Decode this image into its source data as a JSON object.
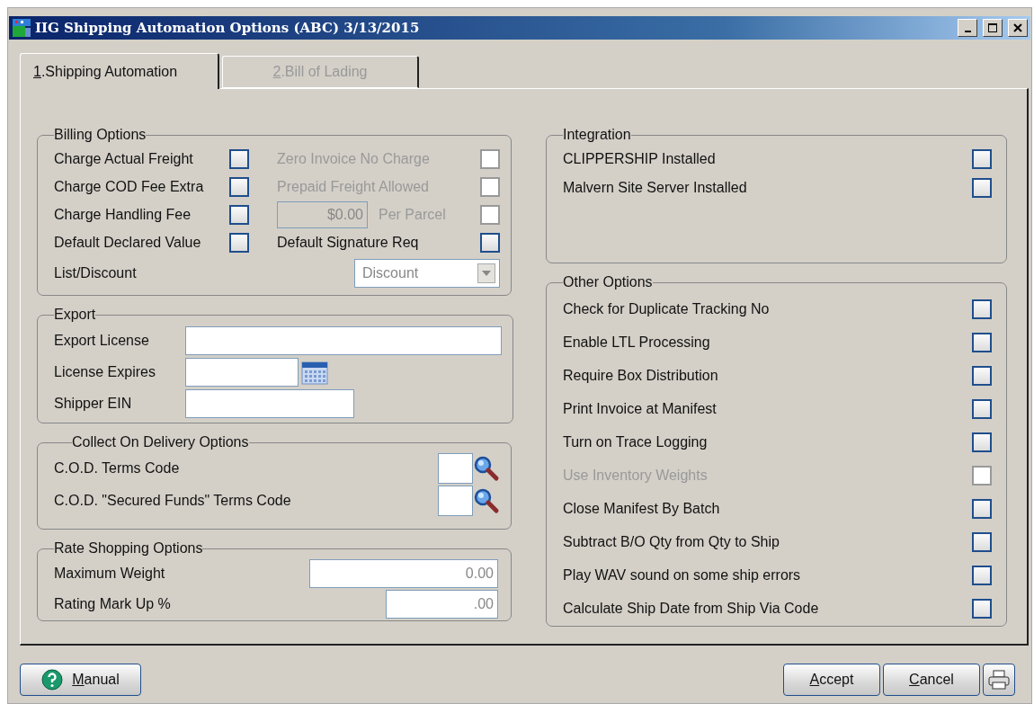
{
  "window": {
    "title": "IIG Shipping Automation Options (ABC) 3/13/2015"
  },
  "tabs": [
    {
      "key": "1",
      "rest": ".Shipping Automation",
      "selected": true
    },
    {
      "key": "2",
      "rest": ".Bill of Lading",
      "selected": false
    }
  ],
  "billing_options": {
    "title": "Billing Options",
    "left": [
      {
        "label": "Charge Actual Freight",
        "checked": false
      },
      {
        "label": "Charge COD Fee Extra",
        "checked": false
      },
      {
        "label": "Charge Handling Fee",
        "checked": false
      },
      {
        "label": "Default Declared Value",
        "checked": false
      }
    ],
    "right": [
      {
        "kind": "checkbox",
        "label": "Zero Invoice No Charge",
        "checked": false,
        "disabled": true
      },
      {
        "kind": "checkbox",
        "label": "Prepaid Freight Allowed",
        "checked": false,
        "disabled": true
      },
      {
        "kind": "amount",
        "value": "$0.00",
        "label": "Per Parcel",
        "checked": false,
        "disabled": true
      },
      {
        "kind": "checkbox",
        "label": "Default Signature Req",
        "checked": false,
        "disabled": false
      }
    ],
    "list_discount": {
      "label": "List/Discount",
      "value": "Discount",
      "disabled": true
    }
  },
  "export": {
    "title": "Export",
    "fields": [
      {
        "label": "Export License",
        "kind": "wide"
      },
      {
        "label": "License Expires",
        "kind": "date"
      },
      {
        "label": "Shipper EIN",
        "kind": "medium"
      }
    ]
  },
  "cod_options": {
    "title": "Collect On Delivery Options",
    "fields": [
      {
        "label": "C.O.D. Terms Code"
      },
      {
        "label": "C.O.D. \"Secured Funds\" Terms Code"
      }
    ]
  },
  "rate_shopping": {
    "title": "Rate Shopping Options",
    "fields": [
      {
        "label": "Maximum Weight",
        "value": "0.00",
        "kind": "wide"
      },
      {
        "label": "Rating Mark Up %",
        "value": ".00",
        "kind": "short"
      }
    ]
  },
  "integration": {
    "title": "Integration",
    "items": [
      {
        "label": "CLIPPERSHIP Installed",
        "checked": false,
        "disabled": false
      },
      {
        "label": "Malvern Site Server Installed",
        "checked": false,
        "disabled": false
      }
    ]
  },
  "other_options": {
    "title": "Other Options",
    "items": [
      {
        "label": "Check for Duplicate Tracking No",
        "checked": false,
        "disabled": false
      },
      {
        "label": "Enable LTL Processing",
        "checked": false,
        "disabled": false
      },
      {
        "label": "Require Box Distribution",
        "checked": false,
        "disabled": false
      },
      {
        "label": "Print Invoice at Manifest",
        "checked": false,
        "disabled": false
      },
      {
        "label": "Turn on Trace Logging",
        "checked": false,
        "disabled": false
      },
      {
        "label": "Use Inventory Weights",
        "checked": false,
        "disabled": true
      },
      {
        "label": "Close Manifest By Batch",
        "checked": false,
        "disabled": false
      },
      {
        "label": "Subtract B/O Qty from Qty to Ship",
        "checked": false,
        "disabled": false
      },
      {
        "label": "Play WAV sound on some ship errors",
        "checked": false,
        "disabled": false
      },
      {
        "label": "Calculate Ship Date from Ship Via Code",
        "checked": false,
        "disabled": false
      }
    ]
  },
  "footer": {
    "manual": {
      "key": "M",
      "rest": "anual"
    },
    "buttons": [
      {
        "key": "A",
        "rest": "ccept"
      },
      {
        "key": "C",
        "rest": "ancel"
      }
    ]
  }
}
